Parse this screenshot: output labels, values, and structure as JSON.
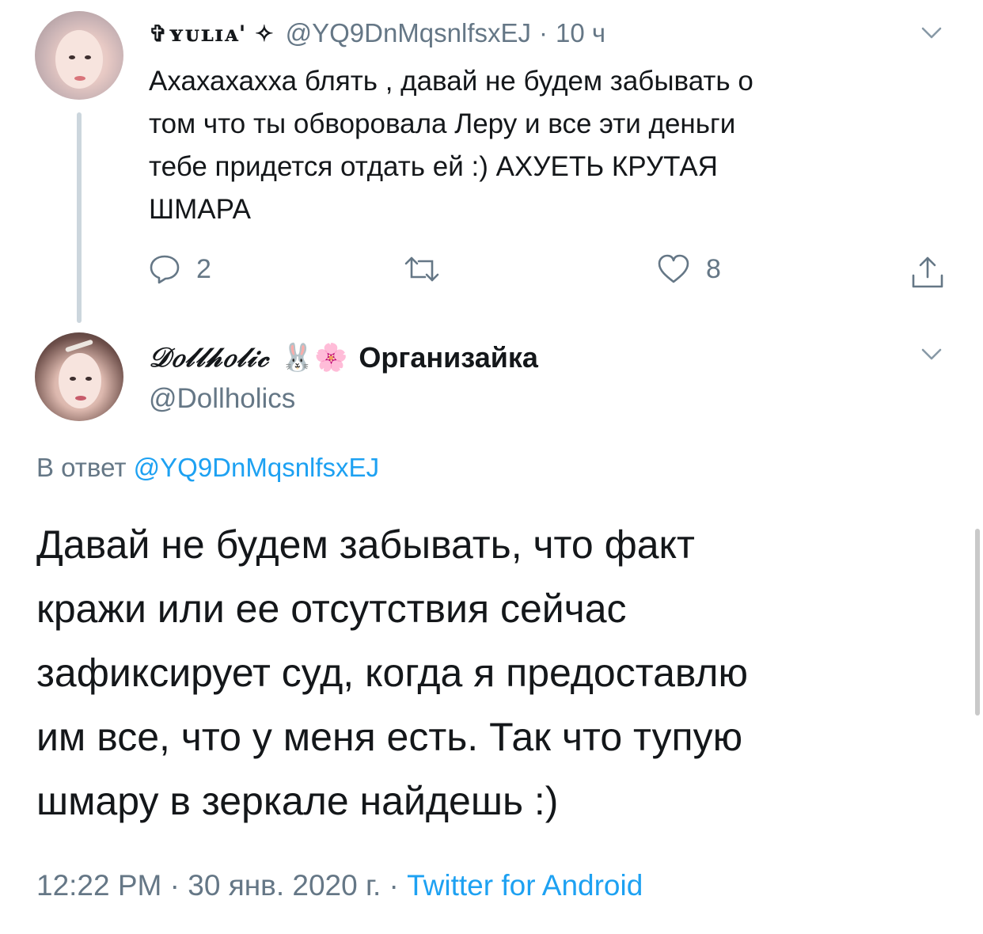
{
  "parent_tweet": {
    "display_name": "✞ʏᴜʟɪᴀ' ✧",
    "handle": "@YQ9DnMqsnlfsxEJ",
    "time_ago": "10 ч",
    "separator": "·",
    "text_lines": [
      "Ахахахахха блять , давай не будем забывать о",
      "том что ты обворовала Леру и все эти деньги",
      "тебе придется отдать ей :)  АХУЕТЬ КРУТАЯ",
      "ШМАРА"
    ],
    "reply_count": "2",
    "retweet_count": "",
    "like_count": "8"
  },
  "main_tweet": {
    "display_name": "𝒟𝑜𝓁𝓁𝒽𝑜𝓁𝒾𝒸",
    "emoji": "🐰🌸",
    "org_label": "Организайка",
    "handle": "@Dollholics",
    "reply_to_label": "В ответ",
    "reply_to_handle": "@YQ9DnMqsnlfsxEJ",
    "text_lines": [
      "Давай не будем забывать, что факт",
      "кражи или ее отсутствия сейчас",
      "зафиксирует суд, когда я предоставлю",
      "им все, что у меня есть. Так что тупую",
      "шмару в зеркале найдешь :)"
    ],
    "time": "12:22 PM",
    "date": "30 янв. 2020 г.",
    "separator": "·",
    "source": "Twitter for Android"
  },
  "icons": [
    "reply-icon",
    "retweet-icon",
    "like-icon",
    "share-icon",
    "chevron-down-icon"
  ],
  "colors": {
    "text": "#14171a",
    "secondary": "#657786",
    "link": "#1da1f2",
    "thread_line": "#ccd6dd"
  }
}
